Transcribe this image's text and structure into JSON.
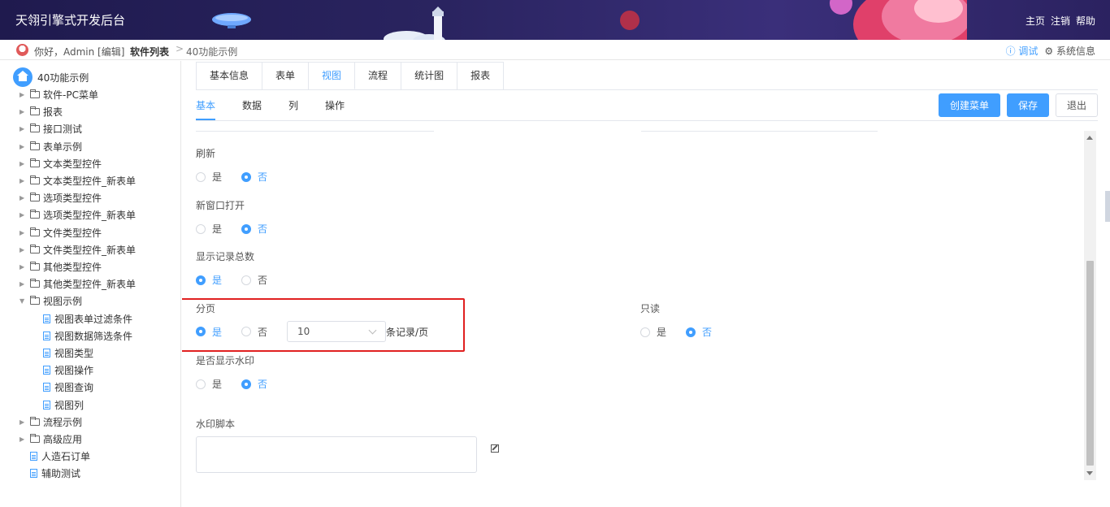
{
  "header": {
    "title": "天翎引擎式开发后台",
    "nav": [
      "主页",
      "注销",
      "帮助"
    ]
  },
  "breadcrumb": {
    "hello": "你好，Admin [编辑]",
    "level1": "软件列表",
    "separator": ">",
    "level2": "40功能示例",
    "debug": "ⓘ 调试",
    "sysinfo": "⚙ 系统信息"
  },
  "sidebar": {
    "root": "40功能示例",
    "items": [
      {
        "label": "软件-PC菜单",
        "type": "folder"
      },
      {
        "label": "报表",
        "type": "folder"
      },
      {
        "label": "接口测试",
        "type": "folder"
      },
      {
        "label": "表单示例",
        "type": "folder"
      },
      {
        "label": "文本类型控件",
        "type": "folder"
      },
      {
        "label": "文本类型控件_新表单",
        "type": "folder"
      },
      {
        "label": "选项类型控件",
        "type": "folder"
      },
      {
        "label": "选项类型控件_新表单",
        "type": "folder"
      },
      {
        "label": "文件类型控件",
        "type": "folder"
      },
      {
        "label": "文件类型控件_新表单",
        "type": "folder"
      },
      {
        "label": "其他类型控件",
        "type": "folder"
      },
      {
        "label": "其他类型控件_新表单",
        "type": "folder"
      },
      {
        "label": "视图示例",
        "type": "folder-open"
      },
      {
        "label": "视图表单过滤条件",
        "type": "doc-child"
      },
      {
        "label": "视图数据筛选条件",
        "type": "doc-child"
      },
      {
        "label": "视图类型",
        "type": "doc-child"
      },
      {
        "label": "视图操作",
        "type": "doc-child"
      },
      {
        "label": "视图查询",
        "type": "doc-child"
      },
      {
        "label": "视图列",
        "type": "doc-child"
      },
      {
        "label": "流程示例",
        "type": "folder"
      },
      {
        "label": "高级应用",
        "type": "folder"
      },
      {
        "label": "人造石订单",
        "type": "doc"
      },
      {
        "label": "辅助测试",
        "type": "doc"
      }
    ]
  },
  "tabs": [
    "基本信息",
    "表单",
    "视图",
    "流程",
    "统计图",
    "报表"
  ],
  "active_tab": "视图",
  "subtabs": [
    "基本",
    "数据",
    "列",
    "操作"
  ],
  "active_subtab": "基本",
  "buttons": {
    "create_menu": "创建菜单",
    "save": "保存",
    "exit": "退出"
  },
  "form": {
    "refresh": {
      "label": "刷新",
      "options": [
        "是",
        "否"
      ],
      "selected": "否"
    },
    "new_window": {
      "label": "新窗口打开",
      "options": [
        "是",
        "否"
      ],
      "selected": "否"
    },
    "show_total": {
      "label": "显示记录总数",
      "options": [
        "是",
        "否"
      ],
      "selected": "是"
    },
    "paging": {
      "label": "分页",
      "options": [
        "是",
        "否"
      ],
      "selected": "是",
      "page_size": "10",
      "suffix": "条记录/页"
    },
    "readonly": {
      "label": "只读",
      "options": [
        "是",
        "否"
      ],
      "selected": "否"
    },
    "watermark": {
      "label": "是否显示水印",
      "options": [
        "是",
        "否"
      ],
      "selected": "否"
    },
    "watermark_script": {
      "label": "水印脚本",
      "value": ""
    }
  },
  "colors": {
    "accent": "#409eff",
    "highlight": "#e02020",
    "header": "#2a2460"
  }
}
